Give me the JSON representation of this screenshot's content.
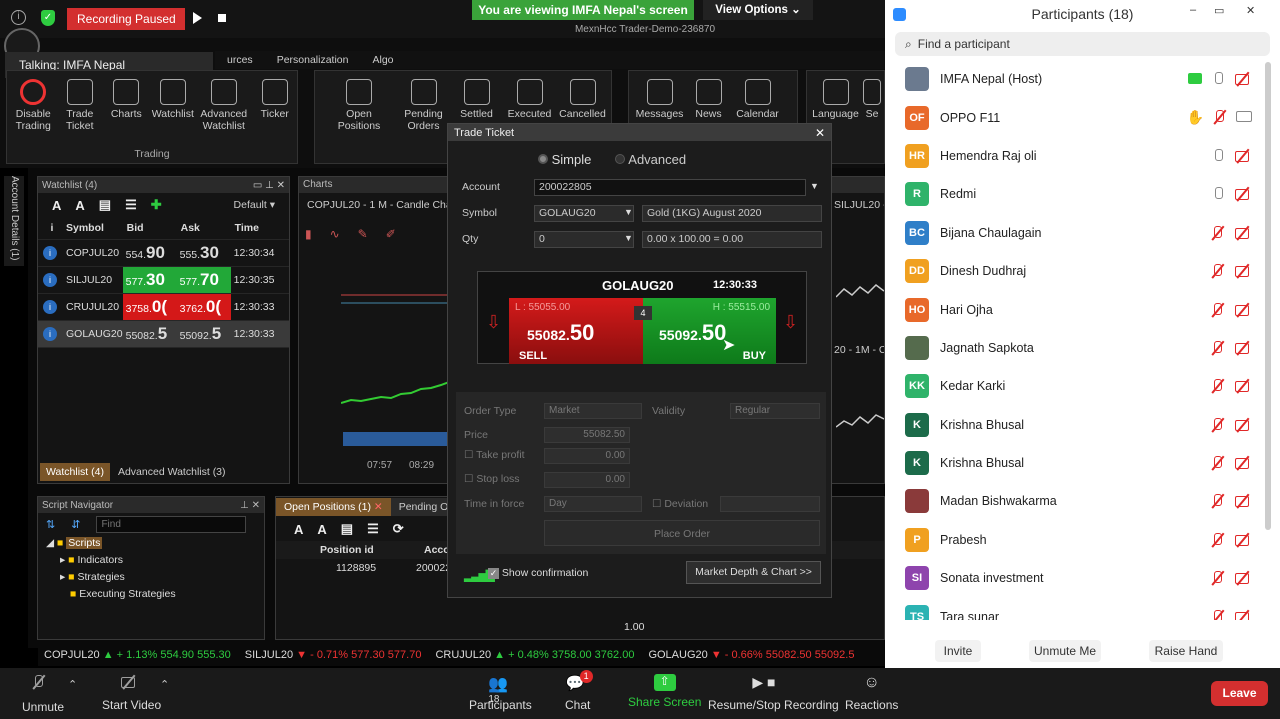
{
  "zoom_top": {
    "recording_label": "Recording Paused",
    "sharing_banner": "You are viewing IMFA Nepal's screen",
    "view_options": "View Options",
    "talking": "Talking: IMFA Nepal"
  },
  "app": {
    "title": "MexnHcc Trader-Demo-236870",
    "menu": [
      "urces",
      "Personalization",
      "Algo"
    ],
    "trading_buttons": [
      "Disable Trading",
      "Trade Ticket",
      "Charts",
      "Watchlist",
      "Advanced Watchlist",
      "Ticker"
    ],
    "trading_group": "Trading",
    "order_buttons": [
      "Open Positions",
      "Pending Orders",
      "Settled",
      "Executed",
      "Cancelled"
    ],
    "misc_buttons": [
      "Messages",
      "News",
      "Calendar"
    ],
    "lang_buttons": [
      "Language",
      "Se"
    ],
    "side_tab": "Account Details (1)"
  },
  "watchlist": {
    "title": "Watchlist (4)",
    "default_label": "Default",
    "columns": [
      "i",
      "Symbol",
      "Bid",
      "Ask",
      "Time"
    ],
    "rows": [
      {
        "symbol": "COPJUL20",
        "bid": "554.",
        "bid_big": "90",
        "ask": "555.",
        "ask_big": "30",
        "time": "12:30:34",
        "state": "none"
      },
      {
        "symbol": "SILJUL20",
        "bid": "577.",
        "bid_big": "30",
        "ask": "577.",
        "ask_big": "70",
        "time": "12:30:35",
        "state": "up"
      },
      {
        "symbol": "CRUJUL20",
        "bid": "3758.",
        "bid_big": "0(",
        "ask": "3762.",
        "ask_big": "0(",
        "time": "12:30:33",
        "state": "down"
      },
      {
        "symbol": "GOLAUG20",
        "bid": "55082.",
        "bid_big": "5",
        "ask": "55092.",
        "ask_big": "5",
        "time": "12:30:33",
        "state": "selected"
      }
    ],
    "tabs": [
      "Watchlist (4)",
      "Advanced Watchlist (3)"
    ]
  },
  "charts": {
    "title": "Charts",
    "chart1": "COPJUL20 - 1 M - Candle Chart",
    "chart2": "SILJUL20 - 1 M - C",
    "chart3": "20 - 1M - C",
    "times": [
      "07:57",
      "08:29"
    ]
  },
  "script_nav": {
    "title": "Script Navigator",
    "find_placeholder": "Find",
    "tree": [
      "Scripts",
      "Indicators",
      "Strategies",
      "Executing Strategies"
    ]
  },
  "positions": {
    "tabs": [
      "Open Positions (1)",
      "Pending O"
    ],
    "columns": [
      "Position id",
      "Acco"
    ],
    "row": [
      "1128895",
      "200022"
    ],
    "footer_value": "1.00"
  },
  "ticket": {
    "title": "Trade Ticket",
    "mode_simple": "Simple",
    "mode_advanced": "Advanced",
    "account_label": "Account",
    "account_value": "200022805",
    "symbol_label": "Symbol",
    "symbol_value": "GOLAUG20",
    "symbol_desc": "Gold (1KG) August 2020",
    "qty_label": "Qty",
    "qty_value": "0",
    "qty_calc": "0.00 x 100.00 = 0.00",
    "quote_symbol": "GOLAUG20",
    "quote_time": "12:30:33",
    "low": "L : 55055.00",
    "high": "H : 55515.00",
    "spread": "4",
    "sell_price_small": "55082.",
    "sell_price_big": "50",
    "buy_price_small": "55092.",
    "buy_price_big": "50",
    "sell": "SELL",
    "buy": "BUY",
    "order_type_label": "Order Type",
    "order_type_value": "Market",
    "validity_label": "Validity",
    "validity_value": "Regular",
    "price_label": "Price",
    "price_value": "55082.50",
    "take_profit_label": "Take profit",
    "take_profit_value": "0.00",
    "stop_loss_label": "Stop loss",
    "stop_loss_value": "0.00",
    "tif_label": "Time in force",
    "tif_value": "Day",
    "deviation_label": "Deviation",
    "place_order": "Place Order",
    "show_confirmation": "Show confirmation",
    "market_depth": "Market Depth & Chart >>"
  },
  "ticker": [
    {
      "sym": "COPJUL20",
      "dir": "▲",
      "chg": "+ 1.13%",
      "bid": "554.90",
      "ask": "555.30",
      "state": "up"
    },
    {
      "sym": "SILJUL20",
      "dir": "▼",
      "chg": "- 0.71%",
      "bid": "577.30",
      "ask": "577.70",
      "state": "dn"
    },
    {
      "sym": "CRUJUL20",
      "dir": "▲",
      "chg": "+ 0.48%",
      "bid": "3758.00",
      "ask": "3762.00",
      "state": "up"
    },
    {
      "sym": "GOLAUG20",
      "dir": "▼",
      "chg": "- 0.66%",
      "bid": "55082.50",
      "ask": "55092.5",
      "state": "dn"
    }
  ],
  "zoom_bottom": {
    "unmute": "Unmute",
    "start_video": "Start Video",
    "participants": "Participants",
    "participants_count": "18",
    "chat": "Chat",
    "chat_badge": "1",
    "share_screen": "Share Screen",
    "recording": "Resume/Stop Recording",
    "reactions": "Reactions",
    "leave": "Leave"
  },
  "participants_panel": {
    "title": "Participants (18)",
    "search_placeholder": "Find a participant",
    "list": [
      {
        "name": "IMFA Nepal (Host)",
        "initials": "",
        "color": "#6b7a8f",
        "mic": "on",
        "photo": true
      },
      {
        "name": "OPPO F11",
        "initials": "OF",
        "color": "#e8692a",
        "mic": "muted",
        "hand": true
      },
      {
        "name": "Hemendra Raj oli",
        "initials": "HR",
        "color": "#f0a020",
        "mic": "on"
      },
      {
        "name": "Redmi",
        "initials": "R",
        "color": "#2fb36a",
        "mic": "on"
      },
      {
        "name": "Bijana Chaulagain",
        "initials": "BC",
        "color": "#2f7fc8",
        "mic": "muted"
      },
      {
        "name": "Dinesh Dudhraj",
        "initials": "DD",
        "color": "#f0a020",
        "mic": "muted"
      },
      {
        "name": "Hari Ojha",
        "initials": "HO",
        "color": "#e8692a",
        "mic": "muted"
      },
      {
        "name": "Jagnath Sapkota",
        "initials": "",
        "color": "#556b4d",
        "mic": "muted",
        "photo": true
      },
      {
        "name": "Kedar Karki",
        "initials": "KK",
        "color": "#2fb36a",
        "mic": "muted"
      },
      {
        "name": "Krishna Bhusal",
        "initials": "K",
        "color": "#1c6b4a",
        "mic": "muted"
      },
      {
        "name": "Krishna Bhusal",
        "initials": "K",
        "color": "#1c6b4a",
        "mic": "muted"
      },
      {
        "name": "Madan Bishwakarma",
        "initials": "",
        "color": "#8a3a3a",
        "mic": "muted",
        "photo": true
      },
      {
        "name": "Prabesh",
        "initials": "P",
        "color": "#f0a020",
        "mic": "muted"
      },
      {
        "name": "Sonata investment",
        "initials": "SI",
        "color": "#8e44ad",
        "mic": "muted"
      },
      {
        "name": "Tara sunar",
        "initials": "TS",
        "color": "#2bb3b3",
        "mic": "muted"
      }
    ],
    "invite": "Invite",
    "unmute_me": "Unmute Me",
    "raise_hand": "Raise Hand"
  }
}
